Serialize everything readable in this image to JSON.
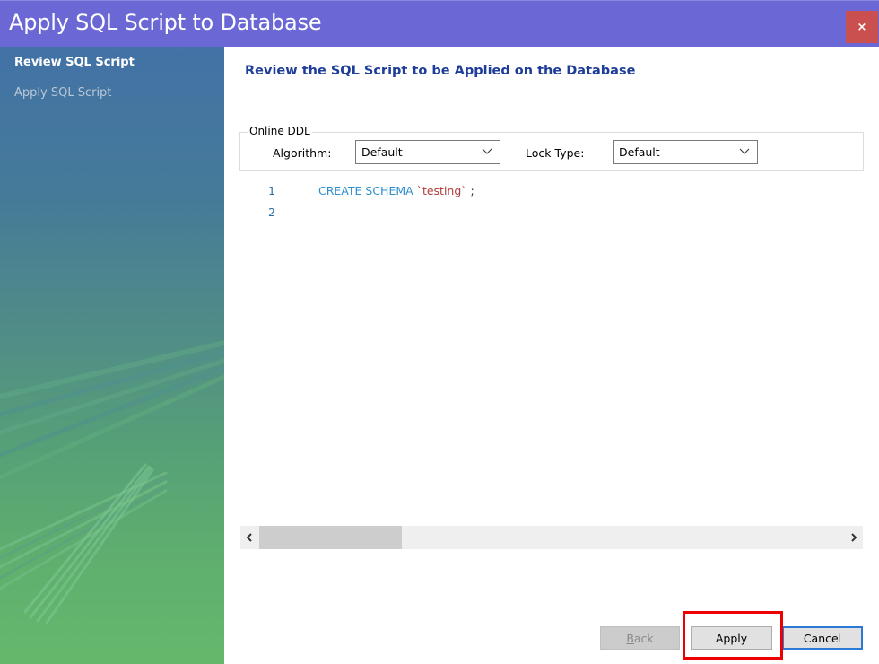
{
  "window": {
    "title": "Apply SQL Script to Database",
    "close_label": "×",
    "titlebar_color": "#6b68d6",
    "close_color": "#c9504f"
  },
  "sidebar": {
    "steps": [
      {
        "label": "Review SQL Script",
        "active": true
      },
      {
        "label": "Apply SQL Script",
        "active": false
      }
    ]
  },
  "main": {
    "heading": "Review the SQL Script to be Applied on the Database",
    "online_ddl": {
      "legend": "Online DDL",
      "algorithm_label": "Algorithm:",
      "algorithm_value": "Default",
      "lock_type_label": "Lock Type:",
      "lock_type_value": "Default"
    },
    "script": {
      "lines": [
        {
          "number": "1",
          "keyword": "CREATE SCHEMA",
          "identifier": "`testing`",
          "terminator": ";"
        },
        {
          "number": "2",
          "keyword": "",
          "identifier": "",
          "terminator": ""
        }
      ]
    },
    "scrollbar": {
      "left_arrow": "<",
      "right_arrow": ">"
    }
  },
  "buttons": {
    "back_prefix": "B",
    "back_rest": "ack",
    "apply": "Apply",
    "cancel": "Cancel",
    "highlight_color": "#ee0000"
  }
}
